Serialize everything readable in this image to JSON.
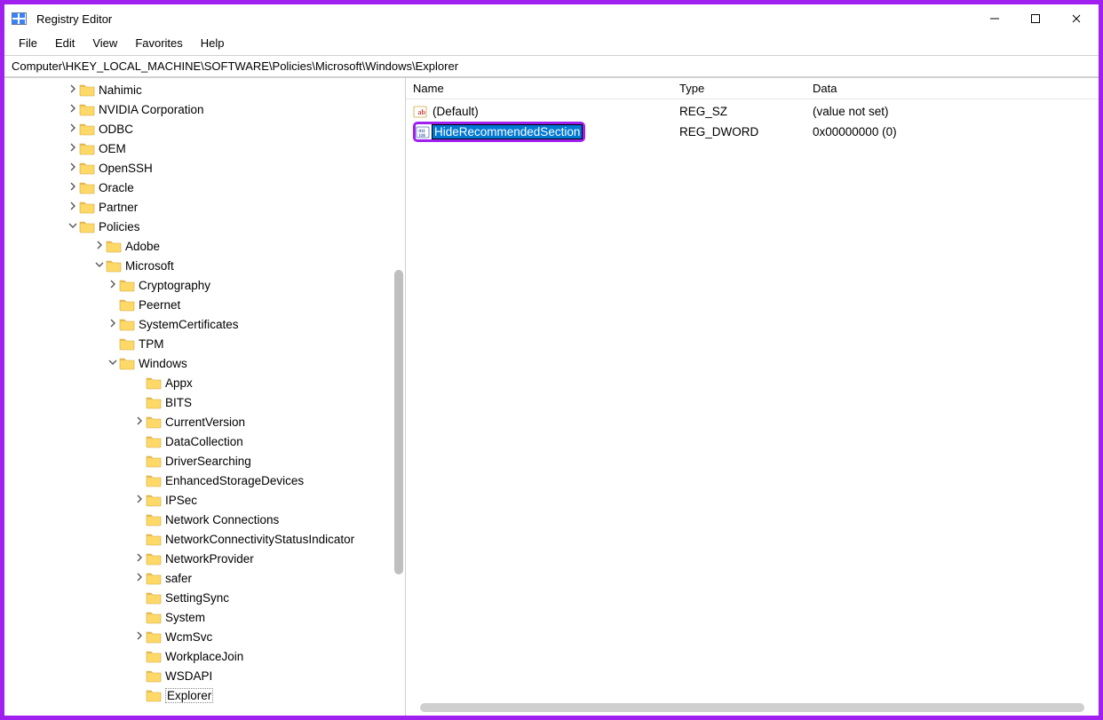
{
  "window": {
    "title": "Registry Editor"
  },
  "menu": {
    "file": "File",
    "edit": "Edit",
    "view": "View",
    "favorites": "Favorites",
    "help": "Help"
  },
  "address": "Computer\\HKEY_LOCAL_MACHINE\\SOFTWARE\\Policies\\Microsoft\\Windows\\Explorer",
  "tree": {
    "nodes": [
      {
        "indent": 70,
        "chevron": "right",
        "label": "Nahimic"
      },
      {
        "indent": 70,
        "chevron": "right",
        "label": "NVIDIA Corporation"
      },
      {
        "indent": 70,
        "chevron": "right",
        "label": "ODBC"
      },
      {
        "indent": 70,
        "chevron": "right",
        "label": "OEM"
      },
      {
        "indent": 70,
        "chevron": "right",
        "label": "OpenSSH"
      },
      {
        "indent": 70,
        "chevron": "right",
        "label": "Oracle"
      },
      {
        "indent": 70,
        "chevron": "right",
        "label": "Partner"
      },
      {
        "indent": 70,
        "chevron": "down",
        "label": "Policies"
      },
      {
        "indent": 100,
        "chevron": "right",
        "label": "Adobe"
      },
      {
        "indent": 100,
        "chevron": "down",
        "label": "Microsoft"
      },
      {
        "indent": 115,
        "chevron": "right",
        "label": "Cryptography"
      },
      {
        "indent": 115,
        "chevron": "",
        "label": "Peernet"
      },
      {
        "indent": 115,
        "chevron": "right",
        "label": "SystemCertificates"
      },
      {
        "indent": 115,
        "chevron": "",
        "label": "TPM"
      },
      {
        "indent": 115,
        "chevron": "down",
        "label": "Windows"
      },
      {
        "indent": 145,
        "chevron": "",
        "label": "Appx"
      },
      {
        "indent": 145,
        "chevron": "",
        "label": "BITS"
      },
      {
        "indent": 145,
        "chevron": "right",
        "label": "CurrentVersion"
      },
      {
        "indent": 145,
        "chevron": "",
        "label": "DataCollection"
      },
      {
        "indent": 145,
        "chevron": "",
        "label": "DriverSearching"
      },
      {
        "indent": 145,
        "chevron": "",
        "label": "EnhancedStorageDevices"
      },
      {
        "indent": 145,
        "chevron": "right",
        "label": "IPSec"
      },
      {
        "indent": 145,
        "chevron": "",
        "label": "Network Connections"
      },
      {
        "indent": 145,
        "chevron": "",
        "label": "NetworkConnectivityStatusIndicator"
      },
      {
        "indent": 145,
        "chevron": "right",
        "label": "NetworkProvider"
      },
      {
        "indent": 145,
        "chevron": "right",
        "label": "safer"
      },
      {
        "indent": 145,
        "chevron": "",
        "label": "SettingSync"
      },
      {
        "indent": 145,
        "chevron": "",
        "label": "System"
      },
      {
        "indent": 145,
        "chevron": "right",
        "label": "WcmSvc"
      },
      {
        "indent": 145,
        "chevron": "",
        "label": "WorkplaceJoin"
      },
      {
        "indent": 145,
        "chevron": "",
        "label": "WSDAPI"
      },
      {
        "indent": 145,
        "chevron": "",
        "label": "Explorer",
        "selected": true
      }
    ]
  },
  "values": {
    "headers": {
      "name": "Name",
      "type": "Type",
      "data": "Data"
    },
    "rows": [
      {
        "icon": "string",
        "name": "(Default)",
        "type": "REG_SZ",
        "data": "(value not set)",
        "editing": false
      },
      {
        "icon": "dword",
        "name": "HideRecommendedSection",
        "type": "REG_DWORD",
        "data": "0x00000000 (0)",
        "editing": true
      }
    ]
  }
}
